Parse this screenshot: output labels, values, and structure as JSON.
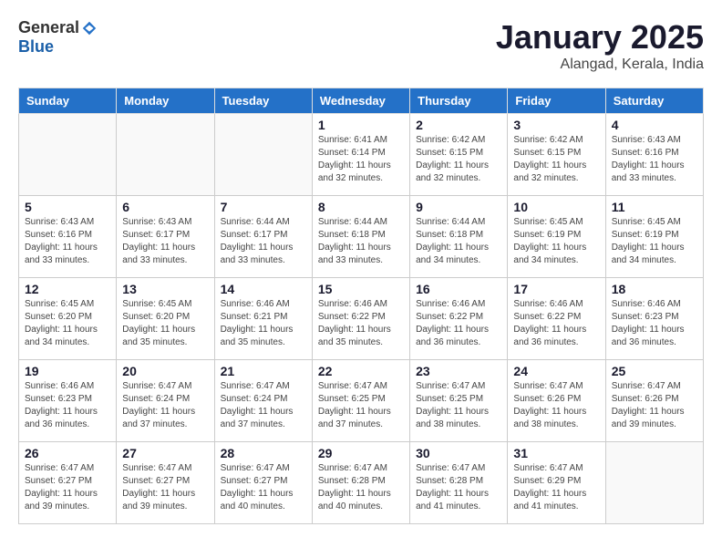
{
  "logo": {
    "general": "General",
    "blue": "Blue"
  },
  "title": "January 2025",
  "subtitle": "Alangad, Kerala, India",
  "days_of_week": [
    "Sunday",
    "Monday",
    "Tuesday",
    "Wednesday",
    "Thursday",
    "Friday",
    "Saturday"
  ],
  "weeks": [
    [
      {
        "day": "",
        "info": ""
      },
      {
        "day": "",
        "info": ""
      },
      {
        "day": "",
        "info": ""
      },
      {
        "day": "1",
        "info": "Sunrise: 6:41 AM\nSunset: 6:14 PM\nDaylight: 11 hours\nand 32 minutes."
      },
      {
        "day": "2",
        "info": "Sunrise: 6:42 AM\nSunset: 6:15 PM\nDaylight: 11 hours\nand 32 minutes."
      },
      {
        "day": "3",
        "info": "Sunrise: 6:42 AM\nSunset: 6:15 PM\nDaylight: 11 hours\nand 32 minutes."
      },
      {
        "day": "4",
        "info": "Sunrise: 6:43 AM\nSunset: 6:16 PM\nDaylight: 11 hours\nand 33 minutes."
      }
    ],
    [
      {
        "day": "5",
        "info": "Sunrise: 6:43 AM\nSunset: 6:16 PM\nDaylight: 11 hours\nand 33 minutes."
      },
      {
        "day": "6",
        "info": "Sunrise: 6:43 AM\nSunset: 6:17 PM\nDaylight: 11 hours\nand 33 minutes."
      },
      {
        "day": "7",
        "info": "Sunrise: 6:44 AM\nSunset: 6:17 PM\nDaylight: 11 hours\nand 33 minutes."
      },
      {
        "day": "8",
        "info": "Sunrise: 6:44 AM\nSunset: 6:18 PM\nDaylight: 11 hours\nand 33 minutes."
      },
      {
        "day": "9",
        "info": "Sunrise: 6:44 AM\nSunset: 6:18 PM\nDaylight: 11 hours\nand 34 minutes."
      },
      {
        "day": "10",
        "info": "Sunrise: 6:45 AM\nSunset: 6:19 PM\nDaylight: 11 hours\nand 34 minutes."
      },
      {
        "day": "11",
        "info": "Sunrise: 6:45 AM\nSunset: 6:19 PM\nDaylight: 11 hours\nand 34 minutes."
      }
    ],
    [
      {
        "day": "12",
        "info": "Sunrise: 6:45 AM\nSunset: 6:20 PM\nDaylight: 11 hours\nand 34 minutes."
      },
      {
        "day": "13",
        "info": "Sunrise: 6:45 AM\nSunset: 6:20 PM\nDaylight: 11 hours\nand 35 minutes."
      },
      {
        "day": "14",
        "info": "Sunrise: 6:46 AM\nSunset: 6:21 PM\nDaylight: 11 hours\nand 35 minutes."
      },
      {
        "day": "15",
        "info": "Sunrise: 6:46 AM\nSunset: 6:22 PM\nDaylight: 11 hours\nand 35 minutes."
      },
      {
        "day": "16",
        "info": "Sunrise: 6:46 AM\nSunset: 6:22 PM\nDaylight: 11 hours\nand 36 minutes."
      },
      {
        "day": "17",
        "info": "Sunrise: 6:46 AM\nSunset: 6:22 PM\nDaylight: 11 hours\nand 36 minutes."
      },
      {
        "day": "18",
        "info": "Sunrise: 6:46 AM\nSunset: 6:23 PM\nDaylight: 11 hours\nand 36 minutes."
      }
    ],
    [
      {
        "day": "19",
        "info": "Sunrise: 6:46 AM\nSunset: 6:23 PM\nDaylight: 11 hours\nand 36 minutes."
      },
      {
        "day": "20",
        "info": "Sunrise: 6:47 AM\nSunset: 6:24 PM\nDaylight: 11 hours\nand 37 minutes."
      },
      {
        "day": "21",
        "info": "Sunrise: 6:47 AM\nSunset: 6:24 PM\nDaylight: 11 hours\nand 37 minutes."
      },
      {
        "day": "22",
        "info": "Sunrise: 6:47 AM\nSunset: 6:25 PM\nDaylight: 11 hours\nand 37 minutes."
      },
      {
        "day": "23",
        "info": "Sunrise: 6:47 AM\nSunset: 6:25 PM\nDaylight: 11 hours\nand 38 minutes."
      },
      {
        "day": "24",
        "info": "Sunrise: 6:47 AM\nSunset: 6:26 PM\nDaylight: 11 hours\nand 38 minutes."
      },
      {
        "day": "25",
        "info": "Sunrise: 6:47 AM\nSunset: 6:26 PM\nDaylight: 11 hours\nand 39 minutes."
      }
    ],
    [
      {
        "day": "26",
        "info": "Sunrise: 6:47 AM\nSunset: 6:27 PM\nDaylight: 11 hours\nand 39 minutes."
      },
      {
        "day": "27",
        "info": "Sunrise: 6:47 AM\nSunset: 6:27 PM\nDaylight: 11 hours\nand 39 minutes."
      },
      {
        "day": "28",
        "info": "Sunrise: 6:47 AM\nSunset: 6:27 PM\nDaylight: 11 hours\nand 40 minutes."
      },
      {
        "day": "29",
        "info": "Sunrise: 6:47 AM\nSunset: 6:28 PM\nDaylight: 11 hours\nand 40 minutes."
      },
      {
        "day": "30",
        "info": "Sunrise: 6:47 AM\nSunset: 6:28 PM\nDaylight: 11 hours\nand 41 minutes."
      },
      {
        "day": "31",
        "info": "Sunrise: 6:47 AM\nSunset: 6:29 PM\nDaylight: 11 hours\nand 41 minutes."
      },
      {
        "day": "",
        "info": ""
      }
    ]
  ]
}
